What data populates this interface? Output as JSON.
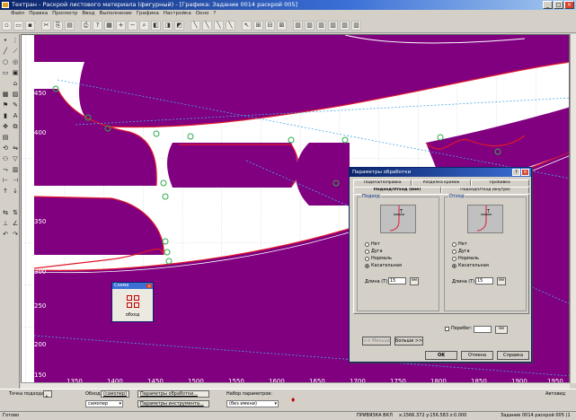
{
  "window": {
    "title": "Техтран - Раскрой листового материала (фигурный) - [Графика: Задание 0014 раскрой 005]",
    "buttons": [
      "_",
      "□",
      "×"
    ]
  },
  "menu": [
    "Файл",
    "Правка",
    "Просмотр",
    "Ввод",
    "Выполнение",
    "Графика",
    "Настройка",
    "Окно",
    "?"
  ],
  "canvas": {
    "y_labels": [
      "400",
      "350",
      "300",
      "250",
      "200",
      "150"
    ],
    "x_labels": [
      "1350",
      "1400",
      "1450",
      "1500",
      "1550",
      "1600",
      "1650",
      "1700",
      "1750",
      "1800",
      "1850",
      "1900",
      "1950"
    ],
    "partial_top_label": "500",
    "partial_row_label": "450",
    "fill_color": "#800080",
    "contour_color": "#e0182c",
    "marker_color": "#2eaa4c",
    "dotted_color": "#4aa8e8"
  },
  "mini_window": {
    "title": "Схема",
    "label": "обход"
  },
  "dialog": {
    "title": "Параметры обработки",
    "tabs_row1": [
      "Подача/Поправка",
      "Разделка кромок",
      "Пробивка"
    ],
    "tabs_row2": [
      "Подход/Отход (вне)",
      "Подход/Отход (внутри)"
    ],
    "approach": {
      "title": "Подход",
      "options": [
        "Нет",
        "Дуга",
        "Нормаль",
        "Касательная"
      ],
      "selected": "Касательная",
      "length_label": "Длина (T):",
      "length_value": "15",
      "btn": "мм"
    },
    "retract": {
      "title": "Отход",
      "options": [
        "Нет",
        "Дуга",
        "Нормаль",
        "Касательная"
      ],
      "selected": "Касательная",
      "length_label": "Длина (T):",
      "length_value": "15",
      "btn": "мм"
    },
    "overrun_label": "Перебег:",
    "overrun_btn": "мм",
    "less_btn": "<< Меньше",
    "more_btn": "Больше >>",
    "ok": "OK",
    "cancel": "Отмена",
    "help": "Справка"
  },
  "bottom": {
    "approach_point_label": "Точка подхода",
    "bypass_label": "Обход",
    "bypass_link": "(самопер)",
    "bypass_select": "самопер",
    "params_btn": "Параметры обработки...",
    "tool_params_btn": "Параметры инструмента...",
    "paramset_label": "Набор параметров:",
    "paramset_select": "(без имени)",
    "autovid": "Автовид"
  },
  "status": {
    "left": "Готово",
    "mode": "ПРИВЯЗКА ВКЛ",
    "coords": "x:1566.372 y:156.583 z:0.000",
    "task": "Задание 0014 раскрой 005 (1"
  }
}
